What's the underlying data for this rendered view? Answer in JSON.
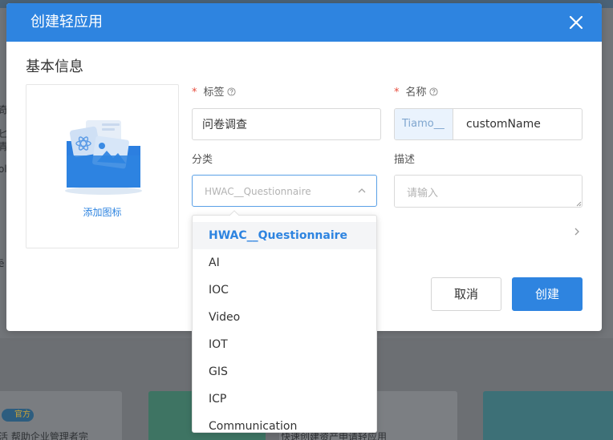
{
  "background": {
    "badge": "官方",
    "snippet_left": "活 帮助企业管理者完",
    "snippet_mid": "快速创建资产申请轻应用",
    "snippet_side_1": "奇",
    "snippet_side_2": "匕",
    "snippet_side_3": "青",
    "snippet_side_4": "ol",
    "snippet_side_5": "ē"
  },
  "dialog": {
    "title": "创建轻应用",
    "section_title": "基本信息",
    "add_icon_label": "添加图标",
    "tag": {
      "label": "标签",
      "required_mark": "*",
      "value": "问卷调查"
    },
    "name": {
      "label": "名称",
      "required_mark": "*",
      "prefix": "Tiamo__",
      "value": "customName"
    },
    "category": {
      "label": "分类",
      "selected": "HWAC__Questionnaire",
      "options": [
        "HWAC__Questionnaire",
        "AI",
        "IOC",
        "Video",
        "IOT",
        "GIS",
        "ICP",
        "Communication"
      ]
    },
    "description": {
      "label": "描述",
      "placeholder": "请输入"
    },
    "cancel_label": "取消",
    "create_label": "创建"
  },
  "colors": {
    "primary": "#2e84e0",
    "required": "#e64b3c",
    "prefix_bg": "#eaf3fd"
  }
}
